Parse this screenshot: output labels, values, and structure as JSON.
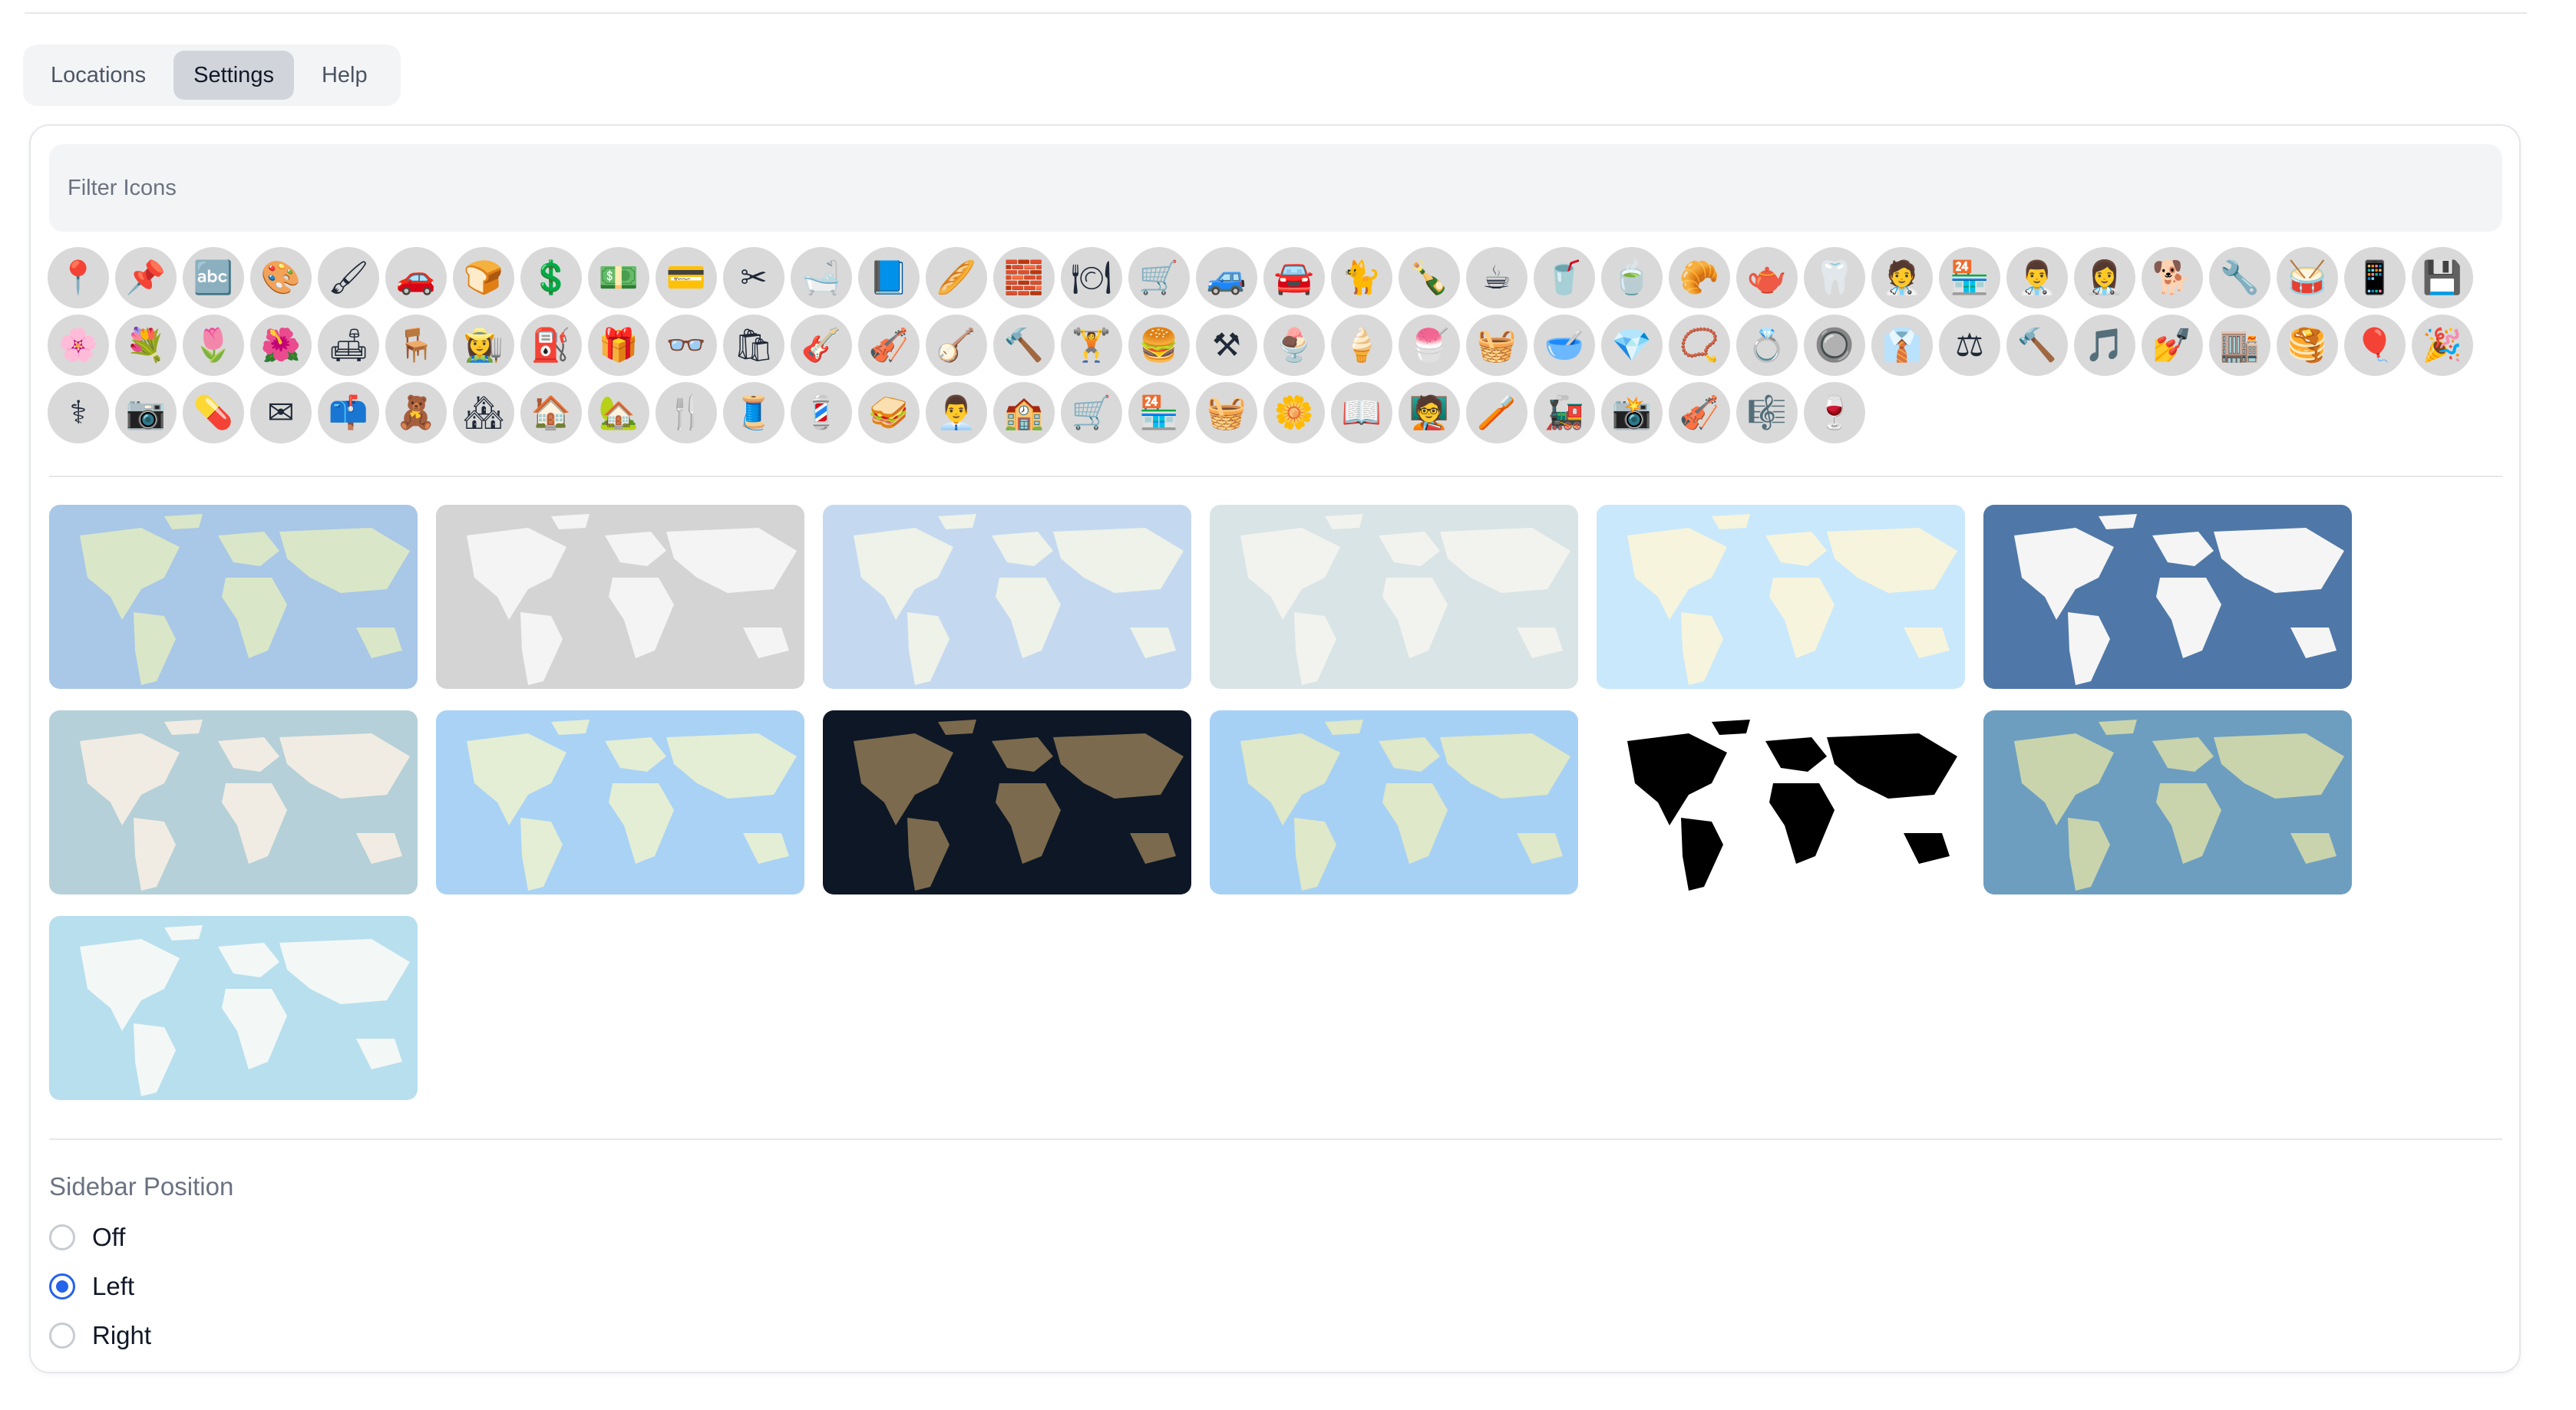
{
  "tabs": [
    {
      "label": "Locations",
      "active": false
    },
    {
      "label": "Settings",
      "active": true
    },
    {
      "label": "Help",
      "active": false
    }
  ],
  "filter": {
    "placeholder": "Filter Icons",
    "value": ""
  },
  "icons": [
    {
      "name": "map-pin-icon",
      "glyph": "📍",
      "bg": "#d9d9d9"
    },
    {
      "name": "round-pushpin-icon",
      "glyph": "📌",
      "bg": "#d9d9d9"
    },
    {
      "name": "abc-icon",
      "glyph": "🔤",
      "bg": "#d9d9d9"
    },
    {
      "name": "palette-icon",
      "glyph": "🎨",
      "bg": "#d9d9d9"
    },
    {
      "name": "paint-palette-icon",
      "glyph": "🖌",
      "bg": "#d9d9d9"
    },
    {
      "name": "car-wash-icon",
      "glyph": "🚗",
      "bg": "#d9d9d9"
    },
    {
      "name": "bakery-icon",
      "glyph": "🍞",
      "bg": "#d9d9d9"
    },
    {
      "name": "dollar-icon",
      "glyph": "💲",
      "bg": "#d9d9d9"
    },
    {
      "name": "bank-icon",
      "glyph": "💵",
      "bg": "#d9d9d9"
    },
    {
      "name": "credit-card-icon",
      "glyph": "💳",
      "bg": "#d9d9d9"
    },
    {
      "name": "scissors-icon",
      "glyph": "✂",
      "bg": "#d9d9d9"
    },
    {
      "name": "bathtub-icon",
      "glyph": "🛁",
      "bg": "#d9d9d9"
    },
    {
      "name": "book-icon",
      "glyph": "📘",
      "bg": "#d9d9d9"
    },
    {
      "name": "bread-icon",
      "glyph": "🥖",
      "bg": "#d9d9d9"
    },
    {
      "name": "blocks-icon",
      "glyph": "🧱",
      "bg": "#d9d9d9"
    },
    {
      "name": "plate-icon",
      "glyph": "🍽",
      "bg": "#d9d9d9"
    },
    {
      "name": "shopping-cart-icon",
      "glyph": "🛒",
      "bg": "#d9d9d9"
    },
    {
      "name": "car-repair-icon",
      "glyph": "🚙",
      "bg": "#d9d9d9"
    },
    {
      "name": "car-icon",
      "glyph": "🚘",
      "bg": "#d9d9d9"
    },
    {
      "name": "cat-icon",
      "glyph": "🐈",
      "bg": "#d9d9d9"
    },
    {
      "name": "champagne-icon",
      "glyph": "🍾",
      "bg": "#d9d9d9"
    },
    {
      "name": "coffee-cup-icon",
      "glyph": "☕",
      "bg": "#d9d9d9"
    },
    {
      "name": "takeaway-coffee-icon",
      "glyph": "🥤",
      "bg": "#d9d9d9"
    },
    {
      "name": "mug-icon",
      "glyph": "🍵",
      "bg": "#d9d9d9"
    },
    {
      "name": "croissant-icon",
      "glyph": "🥐",
      "bg": "#d9d9d9"
    },
    {
      "name": "tea-cup-icon",
      "glyph": "🫖",
      "bg": "#d9d9d9"
    },
    {
      "name": "dentist-icon",
      "glyph": "🦷",
      "bg": "#d9d9d9"
    },
    {
      "name": "doctor-icon",
      "glyph": "🧑‍⚕️",
      "bg": "#d9d9d9"
    },
    {
      "name": "shop-counter-icon",
      "glyph": "🏪",
      "bg": "#d9d9d9"
    },
    {
      "name": "nurse-icon",
      "glyph": "👨‍⚕️",
      "bg": "#d9d9d9"
    },
    {
      "name": "health-worker-icon",
      "glyph": "👩‍⚕️",
      "bg": "#d9d9d9"
    },
    {
      "name": "dog-icon",
      "glyph": "🐕",
      "bg": "#d9d9d9"
    },
    {
      "name": "drill-icon",
      "glyph": "🔧",
      "bg": "#d9d9d9"
    },
    {
      "name": "drum-icon",
      "glyph": "🥁",
      "bg": "#d9d9d9"
    },
    {
      "name": "devices-icon",
      "glyph": "📱",
      "bg": "#d9d9d9"
    },
    {
      "name": "chip-icon",
      "glyph": "💾",
      "bg": "#d9d9d9"
    },
    {
      "name": "pansy-icon",
      "glyph": "🌸",
      "bg": "#d9d9d9"
    },
    {
      "name": "tulip-bouquet-icon",
      "glyph": "💐",
      "bg": "#d9d9d9"
    },
    {
      "name": "tulip-icon",
      "glyph": "🌷",
      "bg": "#d9d9d9"
    },
    {
      "name": "flower-icon",
      "glyph": "🌺",
      "bg": "#d9d9d9"
    },
    {
      "name": "sofa-icon",
      "glyph": "🛋",
      "bg": "#d9d9d9"
    },
    {
      "name": "chair-icon",
      "glyph": "🪑",
      "bg": "#d9d9d9"
    },
    {
      "name": "gardener-icon",
      "glyph": "👩‍🌾",
      "bg": "#d9d9d9"
    },
    {
      "name": "fuel-pump-icon",
      "glyph": "⛽",
      "bg": "#d9d9d9"
    },
    {
      "name": "gift-icon",
      "glyph": "🎁",
      "bg": "#d9d9d9"
    },
    {
      "name": "glasses-icon",
      "glyph": "👓",
      "bg": "#d9d9d9"
    },
    {
      "name": "grocery-bag-icon",
      "glyph": "🛍",
      "bg": "#d9d9d9"
    },
    {
      "name": "electric-guitar-icon",
      "glyph": "🎸",
      "bg": "#d9d9d9"
    },
    {
      "name": "bass-guitar-icon",
      "glyph": "🎻",
      "bg": "#d9d9d9"
    },
    {
      "name": "acoustic-guitar-icon",
      "glyph": "🪕",
      "bg": "#d9d9d9"
    },
    {
      "name": "hammer-tool-icon",
      "glyph": "🔨",
      "bg": "#d9d9d9"
    },
    {
      "name": "dumbbell-icon",
      "glyph": "🏋",
      "bg": "#d9d9d9"
    },
    {
      "name": "burger-icon",
      "glyph": "🍔",
      "bg": "#d9d9d9"
    },
    {
      "name": "hammer-icon",
      "glyph": "⚒",
      "bg": "#d9d9d9"
    },
    {
      "name": "ice-cream-bowl-icon",
      "glyph": "🍨",
      "bg": "#d9d9d9"
    },
    {
      "name": "ice-cream-cone-icon",
      "glyph": "🍦",
      "bg": "#d9d9d9"
    },
    {
      "name": "soft-serve-icon",
      "glyph": "🍧",
      "bg": "#d9d9d9"
    },
    {
      "name": "basket-icon",
      "glyph": "🧺",
      "bg": "#d9d9d9"
    },
    {
      "name": "bowl-icon",
      "glyph": "🥣",
      "bg": "#d9d9d9"
    },
    {
      "name": "gem-icon",
      "glyph": "💎",
      "bg": "#d9d9d9"
    },
    {
      "name": "necklace-icon",
      "glyph": "📿",
      "bg": "#d9d9d9"
    },
    {
      "name": "ring-icon",
      "glyph": "💍",
      "bg": "#d9d9d9"
    },
    {
      "name": "washing-machine-icon",
      "glyph": "🔘",
      "bg": "#d9d9d9"
    },
    {
      "name": "laundry-icon",
      "glyph": "👔",
      "bg": "#d9d9d9"
    },
    {
      "name": "scales-icon",
      "glyph": "⚖",
      "bg": "#d9d9d9"
    },
    {
      "name": "gavel-icon",
      "glyph": "🔨",
      "bg": "#d9d9d9"
    },
    {
      "name": "music-icon",
      "glyph": "🎵",
      "bg": "#d9d9d9"
    },
    {
      "name": "nail-polish-icon",
      "glyph": "💅",
      "bg": "#d9d9d9"
    },
    {
      "name": "market-stall-icon",
      "glyph": "🏬",
      "bg": "#d9d9d9"
    },
    {
      "name": "pancakes-icon",
      "glyph": "🥞",
      "bg": "#d9d9d9"
    },
    {
      "name": "balloons-icon",
      "glyph": "🎈",
      "bg": "#d9d9d9"
    },
    {
      "name": "party-popper-icon",
      "glyph": "🎉",
      "bg": "#d9d9d9"
    },
    {
      "name": "pharmacy-icon",
      "glyph": "⚕",
      "bg": "#d9d9d9"
    },
    {
      "name": "camera-icon",
      "glyph": "📷",
      "bg": "#d9d9d9"
    },
    {
      "name": "pill-icon",
      "glyph": "💊",
      "bg": "#d9d9d9"
    },
    {
      "name": "envelope-icon",
      "glyph": "✉",
      "bg": "#d9d9d9"
    },
    {
      "name": "mailbox-icon",
      "glyph": "📫",
      "bg": "#d9d9d9"
    },
    {
      "name": "toy-stacker-icon",
      "glyph": "🧸",
      "bg": "#d9d9d9"
    },
    {
      "name": "real-estate-icon",
      "glyph": "🏘",
      "bg": "#d9d9d9"
    },
    {
      "name": "house-icon",
      "glyph": "🏠",
      "bg": "#d9d9d9"
    },
    {
      "name": "cabin-icon",
      "glyph": "🏡",
      "bg": "#d9d9d9"
    },
    {
      "name": "restaurant-icon",
      "glyph": "🍴",
      "bg": "#d9d9d9"
    },
    {
      "name": "tailor-icon",
      "glyph": "🧵",
      "bg": "#d9d9d9"
    },
    {
      "name": "barber-icon",
      "glyph": "💈",
      "bg": "#d9d9d9"
    },
    {
      "name": "sandwich-icon",
      "glyph": "🥪",
      "bg": "#d9d9d9"
    },
    {
      "name": "businessman-icon",
      "glyph": "👨‍💼",
      "bg": "#d9d9d9"
    },
    {
      "name": "school-icon",
      "glyph": "🏫",
      "bg": "#d9d9d9"
    },
    {
      "name": "shopping-trolley-icon",
      "glyph": "🛒",
      "bg": "#d9d9d9"
    },
    {
      "name": "storefront-icon",
      "glyph": "🏪",
      "bg": "#d9d9d9"
    },
    {
      "name": "shopping-basket-icon",
      "glyph": "🧺",
      "bg": "#d9d9d9"
    },
    {
      "name": "sunflower-icon",
      "glyph": "🌼",
      "bg": "#d9d9d9"
    },
    {
      "name": "open-book-icon",
      "glyph": "📖",
      "bg": "#d9d9d9"
    },
    {
      "name": "teacher-icon",
      "glyph": "🧑‍🏫",
      "bg": "#d9d9d9"
    },
    {
      "name": "toothbrush-icon",
      "glyph": "🪥",
      "bg": "#d9d9d9"
    },
    {
      "name": "toy-train-icon",
      "glyph": "🚂",
      "bg": "#d9d9d9"
    },
    {
      "name": "photo-camera-icon",
      "glyph": "📸",
      "bg": "#d9d9d9"
    },
    {
      "name": "violin-icon",
      "glyph": "🎻",
      "bg": "#d9d9d9"
    },
    {
      "name": "violinist-icon",
      "glyph": "🎼",
      "bg": "#d9d9d9"
    },
    {
      "name": "wine-icon",
      "glyph": "🍷",
      "bg": "#d9d9d9"
    }
  ],
  "map_styles": [
    {
      "name": "map-style-1",
      "ocean": "#a9c7e6",
      "land": "#d9e7c8"
    },
    {
      "name": "map-style-2",
      "ocean": "#d4d4d4",
      "land": "#f4f4f4"
    },
    {
      "name": "map-style-3",
      "ocean": "#c4d9f0",
      "land": "#eef2e8"
    },
    {
      "name": "map-style-4",
      "ocean": "#d9e4e6",
      "land": "#f2f3ee"
    },
    {
      "name": "map-style-5",
      "ocean": "#c9e8fb",
      "land": "#f7f4dd"
    },
    {
      "name": "map-style-6",
      "ocean": "#4f78a8",
      "land": "#f5f5f5"
    },
    {
      "name": "map-style-7",
      "ocean": "#b5d0d8",
      "land": "#f1ece3"
    },
    {
      "name": "map-style-8",
      "ocean": "#a9d2f5",
      "land": "#e4eed5"
    },
    {
      "name": "map-style-9",
      "ocean": "#0d1726",
      "land": "#7b6a4d"
    },
    {
      "name": "map-style-10",
      "ocean": "#a7d1f4",
      "land": "#dfe8c8"
    },
    {
      "name": "map-style-11",
      "ocean": "#ffffff",
      "land": "#000000"
    },
    {
      "name": "map-style-12",
      "ocean": "#6d9ec0",
      "land": "#c9d4ad"
    },
    {
      "name": "map-style-13",
      "ocean": "#b8dfee",
      "land": "#f3f8f6"
    }
  ],
  "sidebar": {
    "label": "Sidebar Position",
    "options": [
      {
        "label": "Off",
        "checked": false
      },
      {
        "label": "Left",
        "checked": true
      },
      {
        "label": "Right",
        "checked": false
      }
    ]
  },
  "colors": {
    "accent": "#2563eb",
    "tab_active_bg": "#d1d5db",
    "card_border": "#e5e7eb"
  }
}
